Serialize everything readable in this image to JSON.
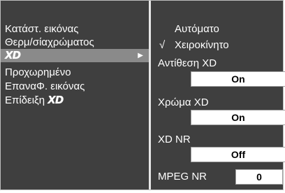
{
  "menu": {
    "items": [
      {
        "label": "Κατάστ. εικόνας"
      },
      {
        "label": "Θερμ/σίαχρώματος"
      },
      {
        "label": "XD",
        "submenu_arrow": "▶"
      },
      {
        "label": "Προχωρημένο"
      },
      {
        "label": "ΕπαναΦ. εικόνας"
      },
      {
        "label": "Επίδειξη",
        "logo": "XD"
      }
    ],
    "selected_index": 2
  },
  "submenu": {
    "mode_options": [
      {
        "label": "Αυτόματο",
        "checked": false
      },
      {
        "label": "Χειροκίνητο",
        "checked": true,
        "check_mark": "√"
      }
    ],
    "contrast_xd": {
      "label": "Αντίθεση XD",
      "value": "On"
    },
    "color_xd": {
      "label": "Χρώμα XD",
      "value": "On"
    },
    "xd_nr": {
      "label": "XD NR",
      "value": "Off"
    },
    "mpeg_nr": {
      "label": "MPEG NR",
      "value": "0"
    }
  },
  "colors": {
    "panel_background": "#3f3f3f",
    "selected_highlight": "#8a8a8a",
    "divider": "#e6e6e6"
  }
}
